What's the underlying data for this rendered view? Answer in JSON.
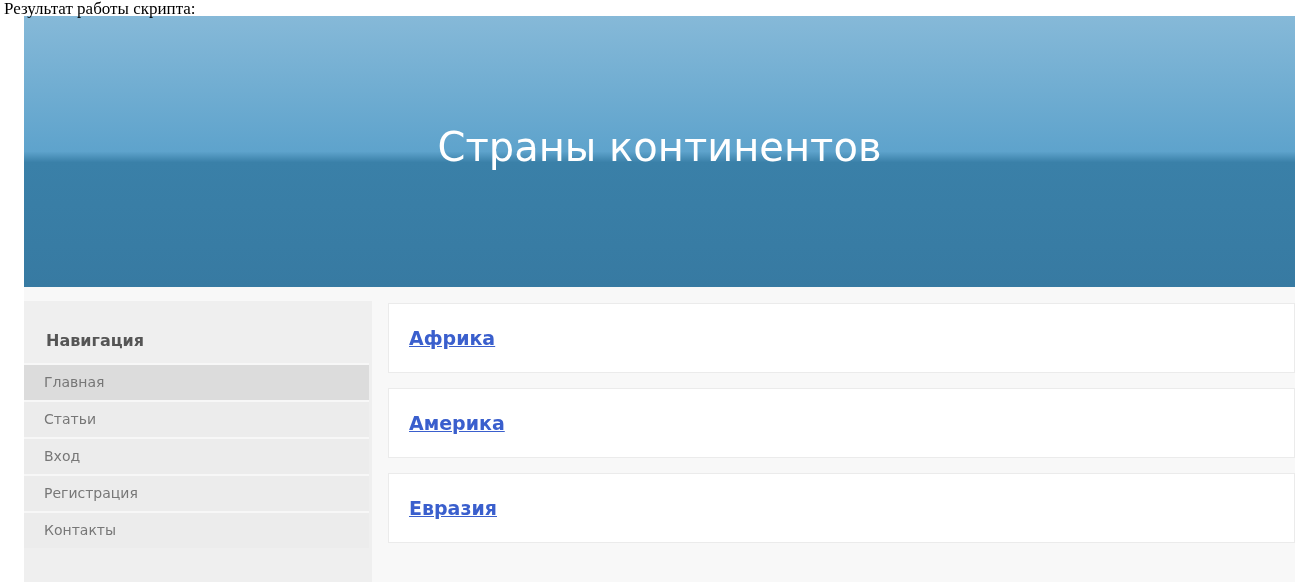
{
  "caption": "Результат работы скрипта:",
  "header": {
    "title": "Страны континентов"
  },
  "sidebar": {
    "heading": "Навигация",
    "items": [
      {
        "label": "Главная",
        "selected": true
      },
      {
        "label": "Статьи",
        "selected": false
      },
      {
        "label": "Вход",
        "selected": false
      },
      {
        "label": "Регистрация",
        "selected": false
      },
      {
        "label": "Контакты",
        "selected": false
      }
    ]
  },
  "continents": [
    {
      "label": "Африка"
    },
    {
      "label": "Америка"
    },
    {
      "label": "Евразия"
    }
  ]
}
